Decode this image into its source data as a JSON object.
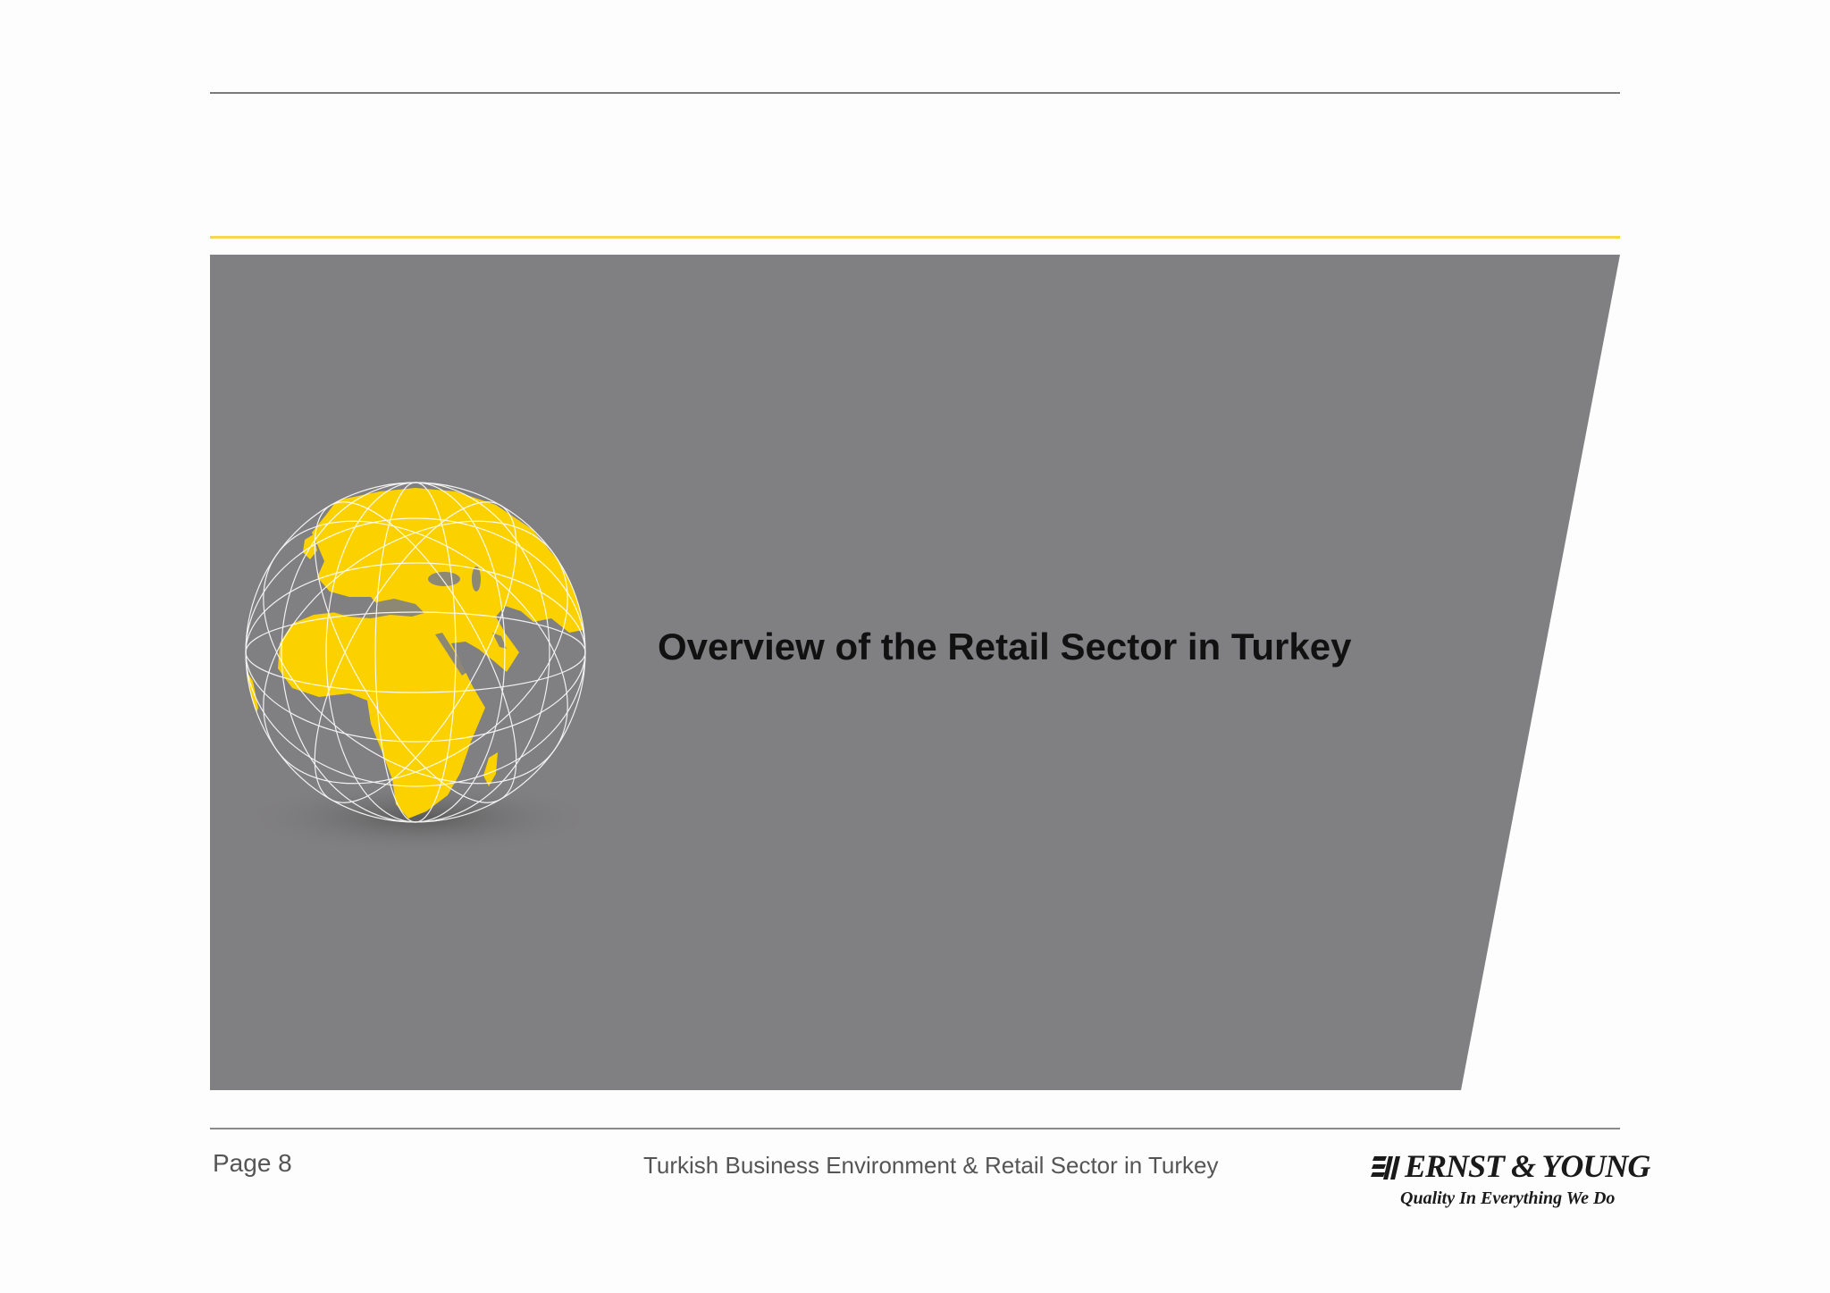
{
  "slide": {
    "title": "Overview of the Retail Sector in Turkey"
  },
  "footer": {
    "page_label": "Page 8",
    "document_title": "Turkish Business Environment & Retail Sector in Turkey"
  },
  "logo": {
    "name": "ERNST & YOUNG",
    "tagline": "Quality In Everything We Do"
  },
  "colors": {
    "banner_gray": "#807f81",
    "accent_yellow": "#f6d74f",
    "globe_yellow": "#fcd100",
    "text_dark": "#111111",
    "footer_text": "#555555"
  },
  "icons": {
    "globe": "globe-illustration",
    "logo_mark": "ey-logo-mark"
  }
}
